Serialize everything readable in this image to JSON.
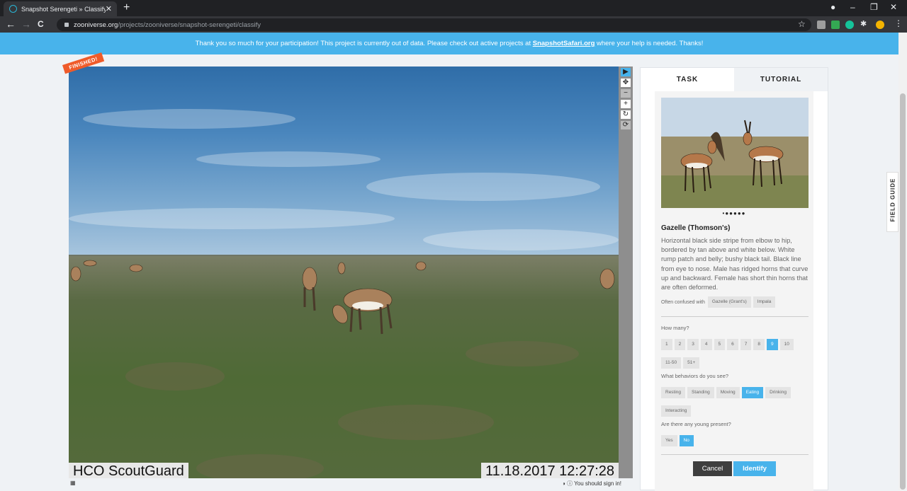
{
  "browser": {
    "tab_title": "Snapshot Serengeti » Classify —",
    "tab_close": "✕",
    "new_tab": "+",
    "url_host": "zooniverse.org",
    "url_path": "/projects/zooniverse/snapshot-serengeti/classify",
    "back": "←",
    "forward": "→",
    "reload": "C",
    "minimize": "–",
    "restore": "❐",
    "close": "✕",
    "star": "☆"
  },
  "banner": {
    "text_before": "Thank you so much for your participation! This project is currently out of data. Please check out active projects at ",
    "link": "SnapshotSafari.org",
    "text_after": " where your help is needed. Thanks!"
  },
  "subject": {
    "badge": "FINISHED!",
    "camera_label": "HCO ScoutGuard",
    "timestamp": "11.18.2017 12:27:28",
    "tools": [
      "▶",
      "✥",
      "−",
      "+",
      "↻",
      "⟳"
    ]
  },
  "below_subject": {
    "grid_icon": "▦",
    "signin_text": "You should sign in!"
  },
  "panel": {
    "tabs": [
      "TASK",
      "TUTORIAL"
    ],
    "carousel_dots": "•●●●●●",
    "species_name": "Gazelle (Thomson's)",
    "description": "Horizontal black side stripe from elbow to hip, bordered by tan above and white below. White rump patch and belly; bushy black tail. Black line from eye to nose. Male has ridged horns that curve up and backward. Female has short thin horns that are often deformed.",
    "confused_label": "Often confused with",
    "confused_with": [
      "Gazelle (Grant's)",
      "Impala"
    ],
    "how_many_label": "How many?",
    "how_many_options": [
      "1",
      "2",
      "3",
      "4",
      "5",
      "6",
      "7",
      "8",
      "9",
      "10",
      "11-50",
      "51+"
    ],
    "how_many_selected": "9",
    "behaviors_label": "What behaviors do you see?",
    "behavior_options": [
      "Resting",
      "Standing",
      "Moving",
      "Eating",
      "Drinking",
      "Interacting"
    ],
    "behavior_selected": "Eating",
    "young_label": "Are there any young present?",
    "young_options": [
      "Yes",
      "No"
    ],
    "young_selected": "No",
    "cancel": "Cancel",
    "identify": "Identify"
  },
  "field_guide": "FIELD GUIDE",
  "colors": {
    "accent": "#48b3eb",
    "banner": "#48b3eb",
    "badge": "#ef5b2a",
    "cancel": "#3e3e3e"
  }
}
